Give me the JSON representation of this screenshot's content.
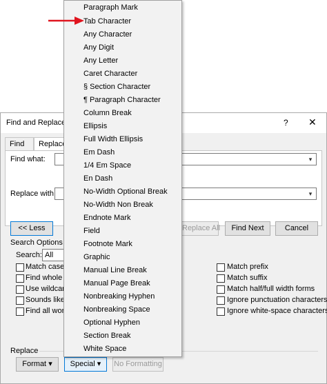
{
  "dialog": {
    "title": "Find and Replace",
    "help_icon": "?",
    "close_icon": "✕",
    "tabs": [
      {
        "label": "Find",
        "mn": "d"
      },
      {
        "label": "Replace",
        "mn": ""
      }
    ],
    "find_what_label": "Find what:",
    "replace_with_label": "Replace with:",
    "less_button": "<< Less",
    "replace_all_button": "Replace All",
    "find_next_button": "Find Next",
    "cancel_button": "Cancel",
    "search_options_label": "Search Options",
    "search_label": "Search:",
    "search_value": "All",
    "left_options": [
      "Match case",
      "Find whole w",
      "Use wildcard",
      "Sounds like (",
      "Find all word"
    ],
    "right_options": [
      "Match prefix",
      "Match suffix",
      "Match half/full width forms",
      "Ignore punctuation characters",
      "Ignore white-space characters"
    ],
    "replace_section_label": "Replace",
    "format_button": "Format",
    "special_button": "Special",
    "no_formatting_button": "No Formatting"
  },
  "menu": {
    "items": [
      "Paragraph Mark",
      "Tab Character",
      "Any Character",
      "Any Digit",
      "Any Letter",
      "Caret Character",
      "§ Section Character",
      "¶ Paragraph Character",
      "Column Break",
      "Ellipsis",
      "Full Width Ellipsis",
      "Em Dash",
      "1/4 Em Space",
      "En Dash",
      "No-Width Optional Break",
      "No-Width Non Break",
      "Endnote Mark",
      "Field",
      "Footnote Mark",
      "Graphic",
      "Manual Line Break",
      "Manual Page Break",
      "Nonbreaking Hyphen",
      "Nonbreaking Space",
      "Optional Hyphen",
      "Section Break",
      "White Space"
    ],
    "highlighted_index": 1
  },
  "colors": {
    "pointer_arrow": "#e0141e",
    "focus_border": "#0078d7"
  }
}
